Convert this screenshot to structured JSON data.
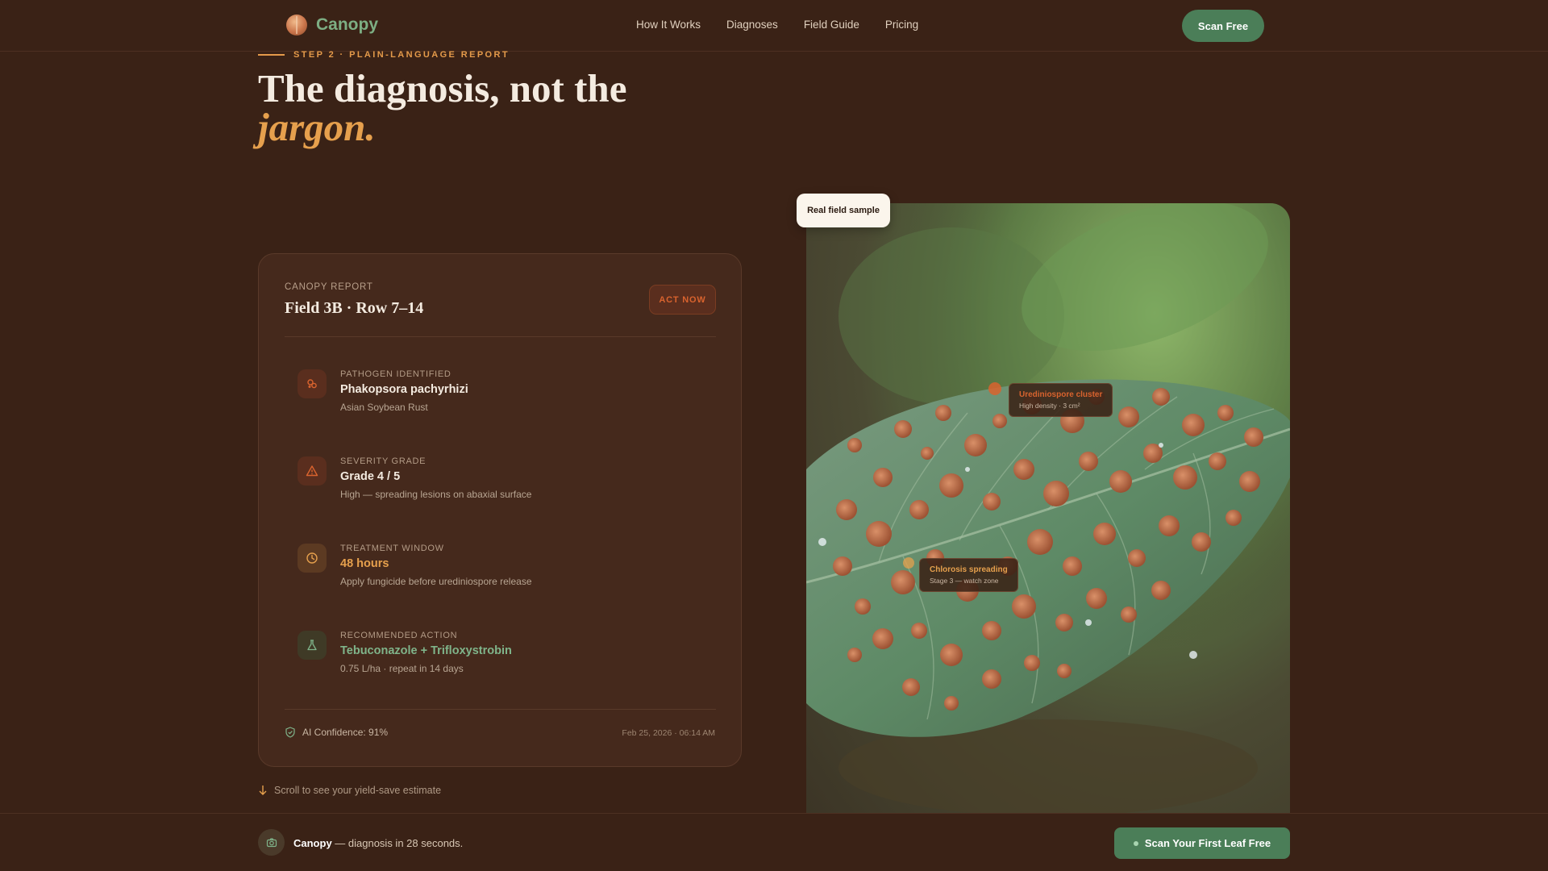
{
  "nav": {
    "brand": "Canopy",
    "links": [
      "How It Works",
      "Diagnoses",
      "Field Guide",
      "Pricing"
    ],
    "cta": "Scan Free"
  },
  "hero": {
    "eyebrow": "STEP 2 · PLAIN-LANGUAGE REPORT",
    "title_main": "The diagnosis, not the",
    "title_accent": "jargon."
  },
  "report": {
    "kicker": "CANOPY REPORT",
    "title": "Field 3B · Row 7–14",
    "badge": "ACT NOW",
    "rows": [
      {
        "label": "PATHOGEN IDENTIFIED",
        "value": "Phakopsora pachyrhizi",
        "sub": "Asian Soybean Rust",
        "icon": "pathogen-icon"
      },
      {
        "label": "SEVERITY GRADE",
        "value": "Grade 4 / 5",
        "sub": "High — spreading lesions on abaxial surface",
        "icon": "warning-icon"
      },
      {
        "label": "TREATMENT WINDOW",
        "value": "48 hours",
        "sub": "Apply fungicide before urediniospore release",
        "icon": "clock-icon"
      },
      {
        "label": "RECOMMENDED ACTION",
        "value": "Tebuconazole + Trifloxystrobin",
        "sub": "0.75 L/ha · repeat in 14 days",
        "icon": "flask-icon"
      }
    ],
    "confidence": "AI Confidence: 91%",
    "timestamp": "Feb 25, 2026 · 06:14 AM"
  },
  "scroll_hint": "Scroll to see your yield-save estimate",
  "photo": {
    "tag": "Real field sample",
    "callouts": [
      {
        "title": "Urediniospore cluster",
        "sub": "High density · 3 cm²",
        "color": "#d9632e"
      },
      {
        "title": "Chlorosis spreading",
        "sub": "Stage 3 — watch zone",
        "color": "#e6a04d"
      }
    ]
  },
  "bottom_bar": {
    "brand": "Canopy",
    "text": " — diagnosis in 28 seconds.",
    "cta": "Scan Your First Leaf Free"
  },
  "colors": {
    "background": "#3a2216",
    "accent_orange": "#e6a04d",
    "accent_green": "#4b7e58",
    "alert": "#d9632e"
  }
}
